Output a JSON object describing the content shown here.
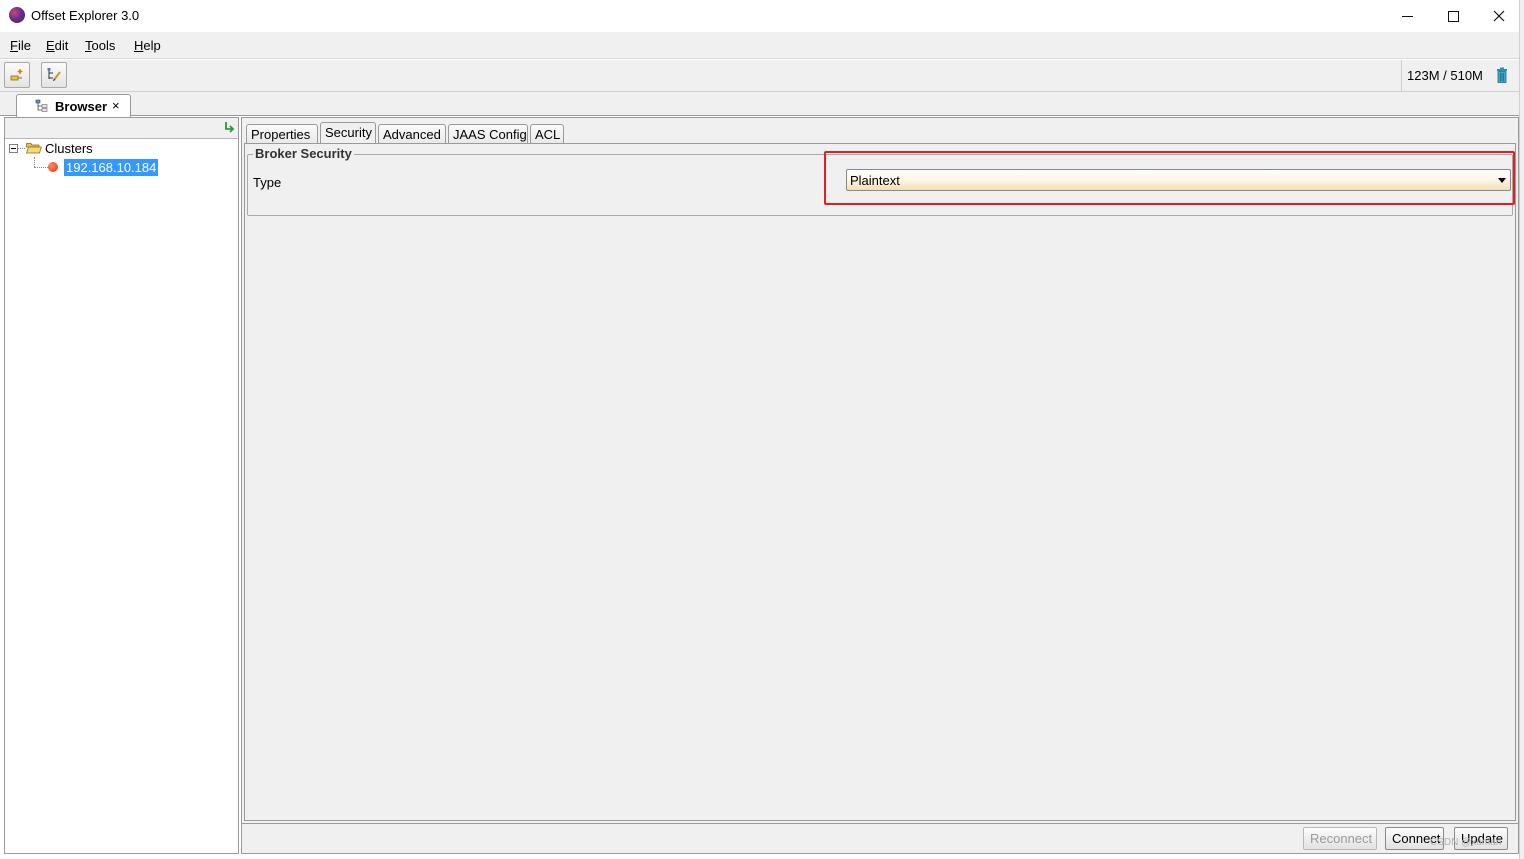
{
  "window": {
    "title": "Offset Explorer  3.0",
    "minimize": "minimize",
    "maximize": "maximize",
    "close": "close"
  },
  "menu": {
    "items": [
      {
        "label": "File",
        "mnemonic": "F",
        "rest": "ile"
      },
      {
        "label": "Edit",
        "mnemonic": "E",
        "rest": "dit"
      },
      {
        "label": "Tools",
        "mnemonic": "T",
        "rest": "ools"
      },
      {
        "label": "Help",
        "mnemonic": "H",
        "rest": "elp"
      }
    ]
  },
  "toolbar": {
    "memory": "123M / 510M",
    "icons": [
      "add-connection-icon",
      "edit-tree-icon",
      "trash-icon"
    ]
  },
  "doc_tab": {
    "label": "Browser",
    "close": "×"
  },
  "tree": {
    "root": "Clusters",
    "nodes": [
      "192.168.10.184"
    ]
  },
  "tabs": [
    "Properties",
    "Security",
    "Advanced",
    "JAAS Config",
    "ACL"
  ],
  "active_tab": "Security",
  "security": {
    "section_title": "Broker Security",
    "type_label": "Type",
    "type_value": "Plaintext"
  },
  "buttons": {
    "reconnect": "Reconnect",
    "connect": "Connect",
    "update": "Update"
  },
  "watermark": "CSDN @xuman",
  "colors": {
    "selection": "#3399ff",
    "highlight": "#e02020",
    "node_status": "#d63a10"
  }
}
